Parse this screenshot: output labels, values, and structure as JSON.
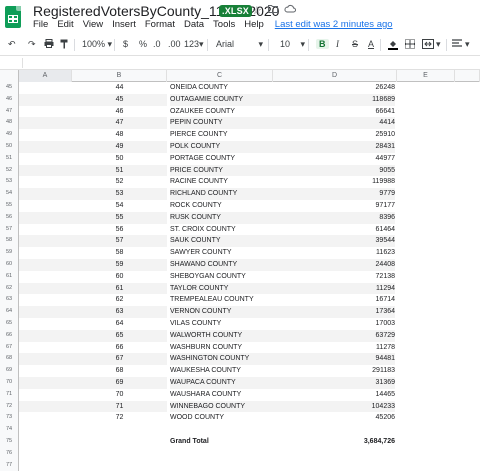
{
  "title_bar": {
    "doc_title": "RegisteredVotersByCounty_11-01-2020",
    "file_badge": ".XLSX",
    "icons": [
      "star-icon",
      "move-to-folder-icon",
      "cloud-status-icon"
    ]
  },
  "menu": {
    "items": [
      "File",
      "Edit",
      "View",
      "Insert",
      "Format",
      "Data",
      "Tools",
      "Help"
    ],
    "last_edit": "Last edit was 2 minutes ago"
  },
  "toolbar": {
    "zoom": "100%",
    "currency": "$",
    "percent": "%",
    "decimal_decrease": ".0",
    "decimal_increase": ".00",
    "more_formats": "123",
    "font": "Arial",
    "font_size": "10",
    "bold": "B",
    "italic": "I",
    "strikethrough": "S",
    "text_color": "A",
    "accent_color": "#0f9d58"
  },
  "columns": [
    "A",
    "B",
    "C",
    "D",
    "E"
  ],
  "rows": [
    {
      "n": "45",
      "b": "44",
      "c": "ONEIDA COUNTY",
      "d": "26248"
    },
    {
      "n": "46",
      "b": "45",
      "c": "OUTAGAMIE COUNTY",
      "d": "118689"
    },
    {
      "n": "47",
      "b": "46",
      "c": "OZAUKEE COUNTY",
      "d": "66641"
    },
    {
      "n": "48",
      "b": "47",
      "c": "PEPIN COUNTY",
      "d": "4414"
    },
    {
      "n": "49",
      "b": "48",
      "c": "PIERCE COUNTY",
      "d": "25910"
    },
    {
      "n": "50",
      "b": "49",
      "c": "POLK COUNTY",
      "d": "28431"
    },
    {
      "n": "51",
      "b": "50",
      "c": "PORTAGE COUNTY",
      "d": "44977"
    },
    {
      "n": "52",
      "b": "51",
      "c": "PRICE COUNTY",
      "d": "9055"
    },
    {
      "n": "53",
      "b": "52",
      "c": "RACINE COUNTY",
      "d": "119988"
    },
    {
      "n": "54",
      "b": "53",
      "c": "RICHLAND COUNTY",
      "d": "9779"
    },
    {
      "n": "55",
      "b": "54",
      "c": "ROCK COUNTY",
      "d": "97177"
    },
    {
      "n": "56",
      "b": "55",
      "c": "RUSK COUNTY",
      "d": "8396"
    },
    {
      "n": "57",
      "b": "56",
      "c": "ST. CROIX COUNTY",
      "d": "61464"
    },
    {
      "n": "58",
      "b": "57",
      "c": "SAUK COUNTY",
      "d": "39544"
    },
    {
      "n": "59",
      "b": "58",
      "c": "SAWYER COUNTY",
      "d": "11623"
    },
    {
      "n": "60",
      "b": "59",
      "c": "SHAWANO COUNTY",
      "d": "24408"
    },
    {
      "n": "61",
      "b": "60",
      "c": "SHEBOYGAN COUNTY",
      "d": "72138"
    },
    {
      "n": "62",
      "b": "61",
      "c": "TAYLOR COUNTY",
      "d": "11294"
    },
    {
      "n": "63",
      "b": "62",
      "c": "TREMPEALEAU COUNTY",
      "d": "16714"
    },
    {
      "n": "64",
      "b": "63",
      "c": "VERNON COUNTY",
      "d": "17364"
    },
    {
      "n": "65",
      "b": "64",
      "c": "VILAS COUNTY",
      "d": "17003"
    },
    {
      "n": "66",
      "b": "65",
      "c": "WALWORTH COUNTY",
      "d": "63729"
    },
    {
      "n": "67",
      "b": "66",
      "c": "WASHBURN COUNTY",
      "d": "11278"
    },
    {
      "n": "68",
      "b": "67",
      "c": "WASHINGTON COUNTY",
      "d": "94481"
    },
    {
      "n": "69",
      "b": "68",
      "c": "WAUKESHA COUNTY",
      "d": "291183"
    },
    {
      "n": "70",
      "b": "69",
      "c": "WAUPACA COUNTY",
      "d": "31369"
    },
    {
      "n": "71",
      "b": "70",
      "c": "WAUSHARA COUNTY",
      "d": "14465"
    },
    {
      "n": "72",
      "b": "71",
      "c": "WINNEBAGO COUNTY",
      "d": "104233"
    },
    {
      "n": "73",
      "b": "72",
      "c": "WOOD COUNTY",
      "d": "45206"
    },
    {
      "n": "74",
      "b": "",
      "c": "",
      "d": ""
    },
    {
      "n": "75",
      "b": "",
      "c": "Grand Total",
      "d": "3,684,726",
      "bold": true
    },
    {
      "n": "76",
      "b": "",
      "c": "",
      "d": ""
    },
    {
      "n": "77",
      "b": "",
      "c": "",
      "d": ""
    }
  ]
}
